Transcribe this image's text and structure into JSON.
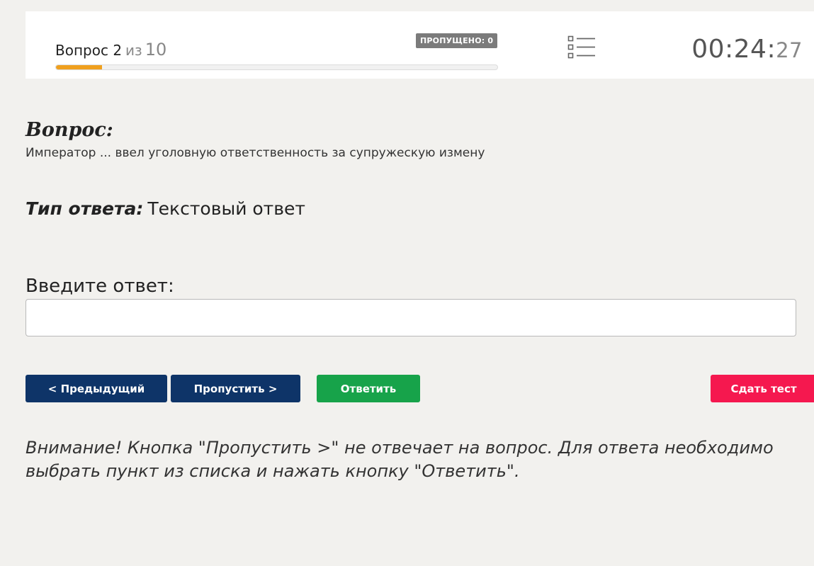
{
  "header": {
    "question_label": "Вопрос 2",
    "of_word": "из",
    "total": "10",
    "skipped_badge": "ПРОПУЩЕНО: 0",
    "progress_fraction": 0.105,
    "timer_main": "00:24:",
    "timer_seconds": "27",
    "progress_color": "#f0a01e",
    "list_icon": "list-icon"
  },
  "question": {
    "heading": "Вопрос:",
    "text": "Император ... ввел уголовную ответственность за супружескую измену"
  },
  "answer_type": {
    "label": "Тип ответа:",
    "value": "Текстовый ответ"
  },
  "input": {
    "label": "Введите ответ:",
    "value": "",
    "placeholder": ""
  },
  "buttons": {
    "prev": "< Предыдущий",
    "skip": "Пропустить >",
    "answer": "Ответить",
    "submit": "Сдать тест"
  },
  "colors": {
    "nav_button": "#0e3468",
    "answer_button": "#17a34a",
    "submit_button": "#f5184f"
  },
  "warning": "Внимание! Кнопка \"Пропустить >\" не отвечает на вопрос. Для ответа необходимо выбрать пункт из списка и нажать кнопку \"Ответить\"."
}
